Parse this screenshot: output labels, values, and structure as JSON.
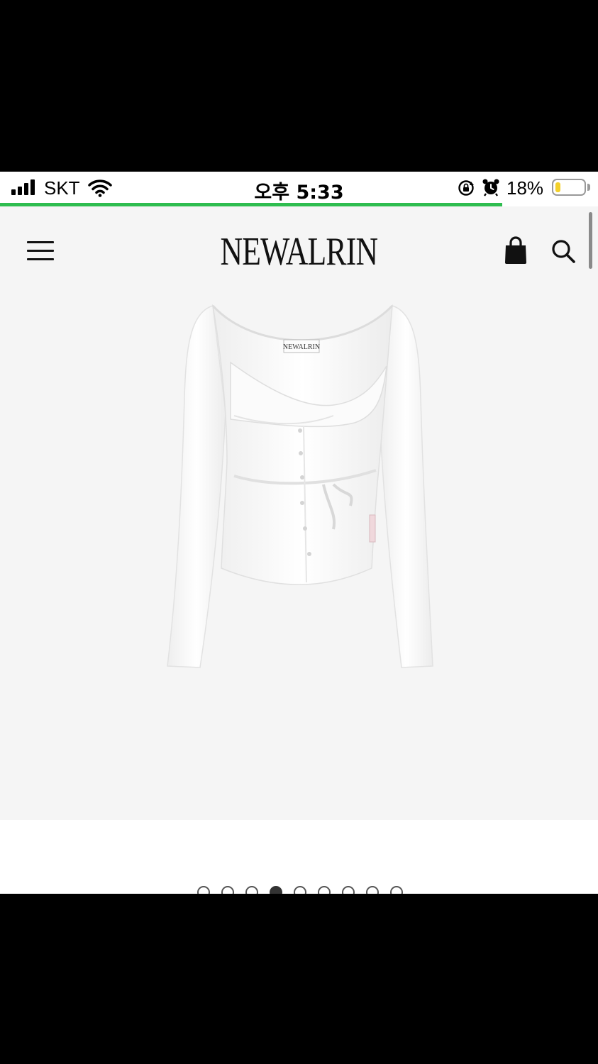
{
  "status_bar": {
    "carrier": "SKT",
    "time": "오후 5:33",
    "battery_percent": "18%",
    "battery_level": 0.18,
    "icons": [
      "signal-icon",
      "wifi-icon",
      "rotation-lock-icon",
      "alarm-icon",
      "battery-icon"
    ]
  },
  "page_load": {
    "progress": 0.84,
    "color": "#2ebd4f"
  },
  "header": {
    "brand": "NEWALRIN",
    "menu_icon": "hamburger-menu-icon",
    "cart_icon": "shopping-bag-icon",
    "search_icon": "search-icon"
  },
  "product": {
    "image_label_text": "NEWALRIN",
    "image_description_icon": "product-photo",
    "background": "#f5f5f5"
  },
  "carousel": {
    "total": 9,
    "active_index": 3
  }
}
